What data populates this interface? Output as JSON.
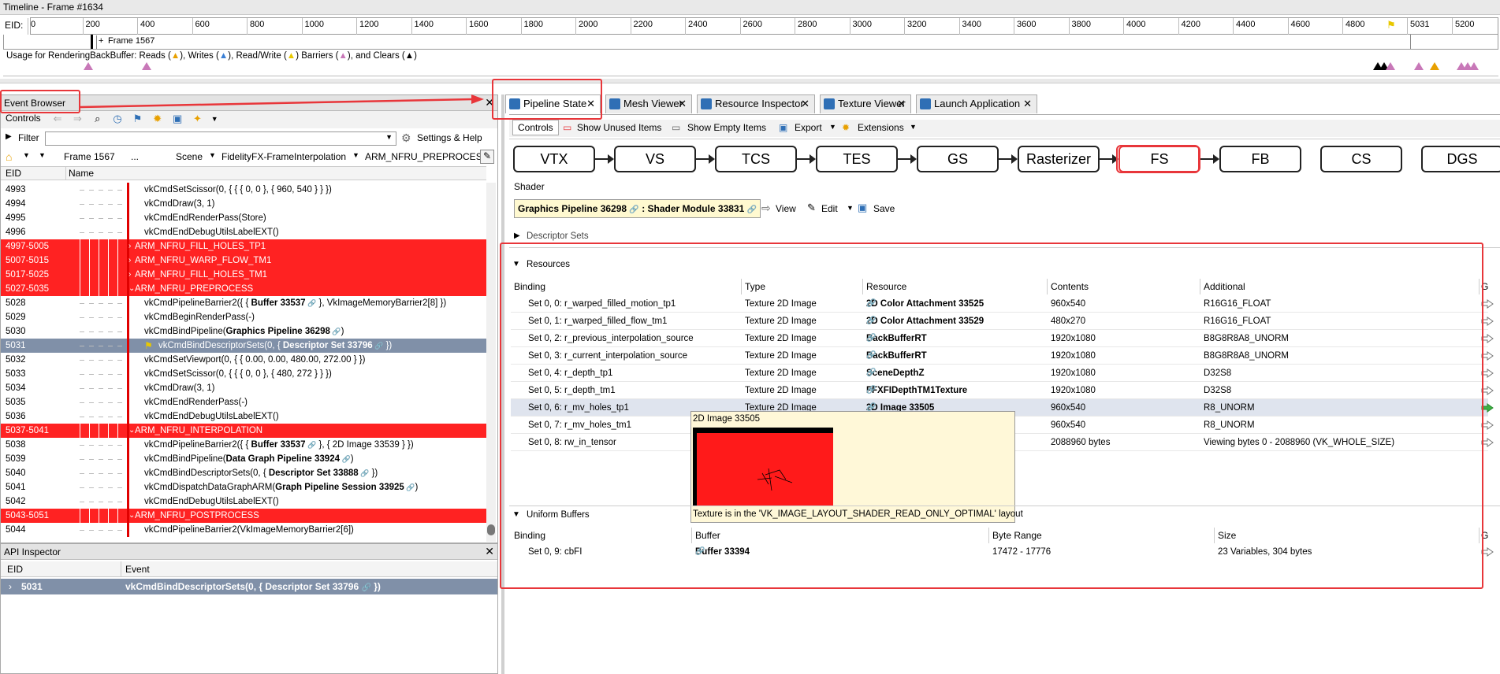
{
  "timeline": {
    "title": "Timeline - Frame #1634",
    "eid_label": "EID:",
    "ticks": [
      "0",
      "200",
      "400",
      "600",
      "800",
      "1000",
      "1200",
      "1400",
      "1600",
      "1800",
      "2000",
      "2200",
      "2400",
      "2600",
      "2800",
      "3000",
      "3200",
      "3400",
      "3600",
      "3800",
      "4000",
      "4200",
      "4400",
      "4600",
      "4800",
      "5031",
      "5200"
    ],
    "frame_label": "Frame 1567",
    "usage_text": "Usage for RenderingBackBuffer: Reads (",
    "usage_parts": [
      "Usage for RenderingBackBuffer: Reads (",
      "), Writes (",
      "), Read/Write (",
      ") Barriers (",
      "), and Clears (",
      ")"
    ]
  },
  "event_browser": {
    "title": "Event Browser",
    "controls_label": "Controls",
    "filter_label": "Filter",
    "settings_label": "Settings & Help",
    "breadcrumb": {
      "frame": "Frame 1567",
      "ellipsis": "...",
      "scene": "Scene",
      "fidelity": "FidelityFX-FrameInterpolation",
      "current": "ARM_NFRU_PREPROCESS"
    },
    "columns": {
      "eid": "EID",
      "name": "Name"
    },
    "rows": [
      {
        "eid": "4993",
        "name": "vkCmdSetScissor(0, { { { 0, 0 }, { 960, 540 } } })",
        "type": "call"
      },
      {
        "eid": "4994",
        "name": "vkCmdDraw(3, 1)",
        "type": "call"
      },
      {
        "eid": "4995",
        "name": "vkCmdEndRenderPass(Store)",
        "type": "call"
      },
      {
        "eid": "4996",
        "name": "vkCmdEndDebugUtilsLabelEXT()",
        "type": "call"
      },
      {
        "eid": "4997-5005",
        "name": "ARM_NFRU_FILL_HOLES_TP1",
        "type": "marker",
        "expand": ">"
      },
      {
        "eid": "5007-5015",
        "name": "ARM_NFRU_WARP_FLOW_TM1",
        "type": "marker",
        "expand": ">"
      },
      {
        "eid": "5017-5025",
        "name": "ARM_NFRU_FILL_HOLES_TM1",
        "type": "marker",
        "expand": ">"
      },
      {
        "eid": "5027-5035",
        "name": "ARM_NFRU_PREPROCESS",
        "type": "marker",
        "expand": "v"
      },
      {
        "eid": "5028",
        "name": "vkCmdPipelineBarrier2({ { Buffer 33537",
        "name_bold": "Buffer 33537",
        "name_pre": "vkCmdPipelineBarrier2({ { ",
        "name_post": " }, VkImageMemoryBarrier2[8] })",
        "type": "call"
      },
      {
        "eid": "5029",
        "name": "vkCmdBeginRenderPass(-)",
        "type": "call"
      },
      {
        "eid": "5030",
        "name_pre": "vkCmdBindPipeline(",
        "name_bold": "Graphics Pipeline 36298",
        "name_post": ")",
        "type": "call"
      },
      {
        "eid": "5031",
        "name_pre": "vkCmdBindDescriptorSets(0, { ",
        "name_bold": "Descriptor Set 33796",
        "name_post": " })",
        "type": "selected"
      },
      {
        "eid": "5032",
        "name": "vkCmdSetViewport(0, { { 0.00, 0.00, 480.00, 272.00 } })",
        "type": "call"
      },
      {
        "eid": "5033",
        "name": "vkCmdSetScissor(0, { { { 0, 0 }, { 480, 272 } } })",
        "type": "call"
      },
      {
        "eid": "5034",
        "name": "vkCmdDraw(3, 1)",
        "type": "call"
      },
      {
        "eid": "5035",
        "name": "vkCmdEndRenderPass(-)",
        "type": "call"
      },
      {
        "eid": "5036",
        "name": "vkCmdEndDebugUtilsLabelEXT()",
        "type": "call"
      },
      {
        "eid": "5037-5041",
        "name": "ARM_NFRU_INTERPOLATION",
        "type": "marker",
        "expand": "v"
      },
      {
        "eid": "5038",
        "name_pre": "vkCmdPipelineBarrier2({ { ",
        "name_bold": "Buffer 33537",
        "name_post": " }, { 2D Image 33539 } })",
        "type": "call"
      },
      {
        "eid": "5039",
        "name_pre": "vkCmdBindPipeline(",
        "name_bold": "Data Graph Pipeline 33924",
        "name_post": ")",
        "type": "call"
      },
      {
        "eid": "5040",
        "name_pre": "vkCmdBindDescriptorSets(0, { ",
        "name_bold": "Descriptor Set 33888",
        "name_post": " })",
        "type": "call"
      },
      {
        "eid": "5041",
        "name_pre": "vkCmdDispatchDataGraphARM(",
        "name_bold": "Graph Pipeline Session 33925",
        "name_post": ")",
        "type": "call"
      },
      {
        "eid": "5042",
        "name": "vkCmdEndDebugUtilsLabelEXT()",
        "type": "call"
      },
      {
        "eid": "5043-5051",
        "name": "ARM_NFRU_POSTPROCESS",
        "type": "marker",
        "expand": "v"
      },
      {
        "eid": "5044",
        "name": "vkCmdPipelineBarrier2(VkImageMemoryBarrier2[6])",
        "type": "call"
      }
    ]
  },
  "api_inspector": {
    "title": "API Inspector",
    "columns": {
      "eid": "EID",
      "event": "Event"
    },
    "row": {
      "eid": "5031",
      "event_pre": "vkCmdBindDescriptorSets(0, { ",
      "event_bold": "Descriptor Set 33796",
      "event_post": " })"
    }
  },
  "tabs": [
    {
      "label": "Pipeline State",
      "active": true
    },
    {
      "label": "Mesh Viewer"
    },
    {
      "label": "Resource Inspector"
    },
    {
      "label": "Texture Viewer"
    },
    {
      "label": "Launch Application"
    }
  ],
  "pipeline_toolbar": {
    "controls": "Controls",
    "show_unused": "Show Unused Items",
    "show_empty": "Show Empty Items",
    "export": "Export",
    "extensions": "Extensions"
  },
  "stages": [
    "VTX",
    "VS",
    "TCS",
    "TES",
    "GS",
    "Rasterizer",
    "FS",
    "FB",
    "CS",
    "DGS"
  ],
  "active_stage": "FS",
  "shader": {
    "section_label": "Shader",
    "pipeline": "Graphics Pipeline 36298",
    "module": "Shader Module 33831",
    "separator": " : ",
    "view": "View",
    "edit": "Edit",
    "save": "Save"
  },
  "descriptor_sets_label": "Descriptor Sets",
  "resources": {
    "label": "Resources",
    "columns": {
      "binding": "Binding",
      "type": "Type",
      "resource": "Resource",
      "contents": "Contents",
      "additional": "Additional",
      "go": "Go"
    },
    "rows": [
      {
        "binding": "Set 0, 0: r_warped_filled_motion_tp1",
        "type": "Texture 2D Image",
        "resource": "2D Color Attachment 33525",
        "contents": "960x540",
        "additional": "R16G16_FLOAT"
      },
      {
        "binding": "Set 0, 1: r_warped_filled_flow_tm1",
        "type": "Texture 2D Image",
        "resource": "2D Color Attachment 33529",
        "contents": "480x270",
        "additional": "R16G16_FLOAT"
      },
      {
        "binding": "Set 0, 2: r_previous_interpolation_source",
        "type": "Texture 2D Image",
        "resource": "BackBufferRT",
        "contents": "1920x1080",
        "additional": "B8G8R8A8_UNORM"
      },
      {
        "binding": "Set 0, 3: r_current_interpolation_source",
        "type": "Texture 2D Image",
        "resource": "BackBufferRT",
        "contents": "1920x1080",
        "additional": "B8G8R8A8_UNORM"
      },
      {
        "binding": "Set 0, 4: r_depth_tp1",
        "type": "Texture 2D Image",
        "resource": "SceneDepthZ",
        "contents": "1920x1080",
        "additional": "D32S8"
      },
      {
        "binding": "Set 0, 5: r_depth_tm1",
        "type": "Texture 2D Image",
        "resource": "FFXFIDepthTM1Texture",
        "contents": "1920x1080",
        "additional": "D32S8"
      },
      {
        "binding": "Set 0, 6: r_mv_holes_tp1",
        "type": "Texture 2D Image",
        "resource": "2D Image 33505",
        "contents": "960x540",
        "additional": "R8_UNORM",
        "highlight": true
      },
      {
        "binding": "Set 0, 7: r_mv_holes_tm1",
        "type": "",
        "resource": "",
        "contents": "960x540",
        "additional": "R8_UNORM"
      },
      {
        "binding": "Set 0, 8: rw_in_tensor",
        "type": "",
        "resource": "",
        "contents": "2088960 bytes",
        "additional": "Viewing bytes 0 - 2088960 (VK_WHOLE_SIZE)"
      }
    ]
  },
  "tooltip": {
    "title": "2D Image 33505",
    "note": "Texture is in the 'VK_IMAGE_LAYOUT_SHADER_READ_ONLY_OPTIMAL' layout"
  },
  "uniform_buffers": {
    "label": "Uniform Buffers",
    "columns": {
      "binding": "Binding",
      "buffer": "Buffer",
      "byte_range": "Byte Range",
      "size": "Size",
      "go": "Go"
    },
    "rows": [
      {
        "binding": "Set 0, 9: cbFI",
        "buffer": "Buffer 33394",
        "byte_range": "17472 - 17776",
        "size": "23 Variables, 304 bytes"
      }
    ]
  },
  "colors": {
    "marker_red": "#ff2222",
    "annotation_red": "#e8363a",
    "selected_row": "#8090a8",
    "accent_blue": "#2f6fb5"
  }
}
